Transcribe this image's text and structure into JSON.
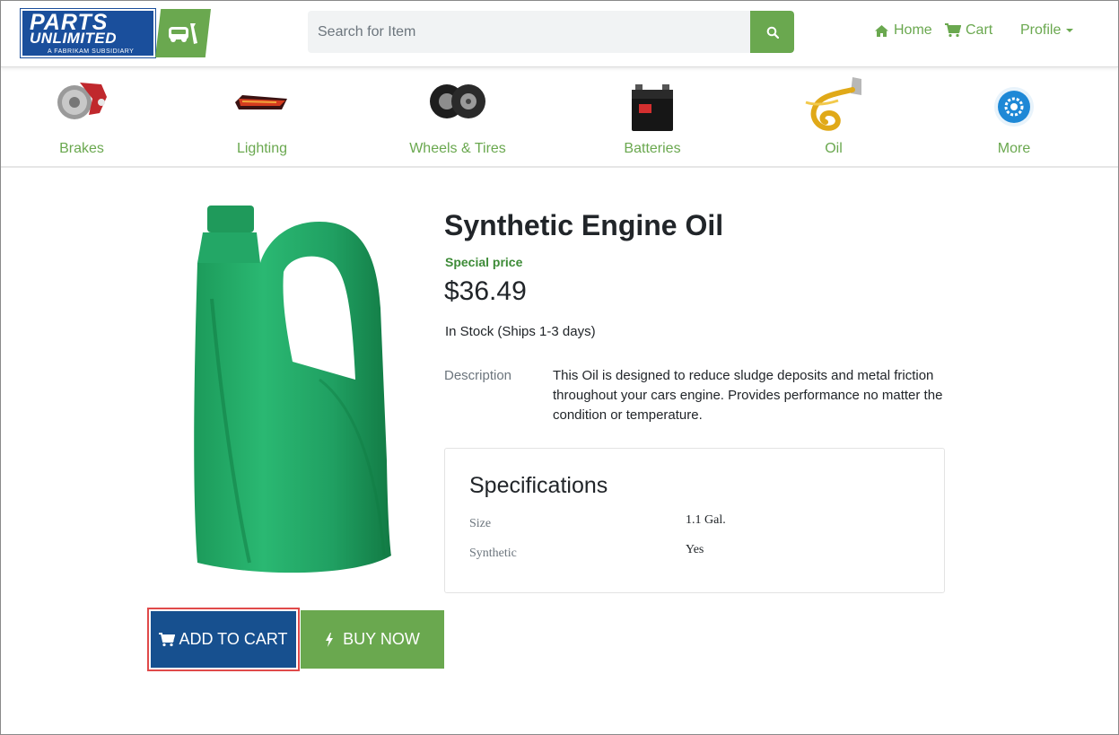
{
  "brand": {
    "name_line1": "PARTS",
    "name_line2": "UNLIMITED",
    "tagline": "A FABRIKAM SUBSIDIARY"
  },
  "search": {
    "placeholder": "Search for Item",
    "button_icon": "search-icon"
  },
  "nav": {
    "home": "Home",
    "cart": "Cart",
    "profile": "Profile"
  },
  "categories": [
    {
      "label": "Brakes",
      "icon": "brakes-image"
    },
    {
      "label": "Lighting",
      "icon": "lighting-image"
    },
    {
      "label": "Wheels & Tires",
      "icon": "wheels-image"
    },
    {
      "label": "Batteries",
      "icon": "battery-image"
    },
    {
      "label": "Oil",
      "icon": "oil-image"
    },
    {
      "label": "More",
      "icon": "more-image"
    }
  ],
  "product": {
    "title": "Synthetic Engine Oil",
    "special_label": "Special price",
    "price": "$36.49",
    "stock": "In Stock (Ships 1-3 days)",
    "description_label": "Description",
    "description": "This Oil is designed to reduce sludge deposits and metal friction throughout your cars engine. Provides performance no matter the condition or temperature.",
    "specs_title": "Specifications",
    "specs": [
      {
        "key": "Size",
        "value": "1.1 Gal."
      },
      {
        "key": "Synthetic",
        "value": "Yes"
      }
    ]
  },
  "actions": {
    "add_to_cart": "ADD TO CART",
    "buy_now": "BUY NOW"
  },
  "colors": {
    "accent_green": "#6aa84f",
    "brand_blue": "#17508f",
    "highlight_red": "#e04a4a"
  }
}
